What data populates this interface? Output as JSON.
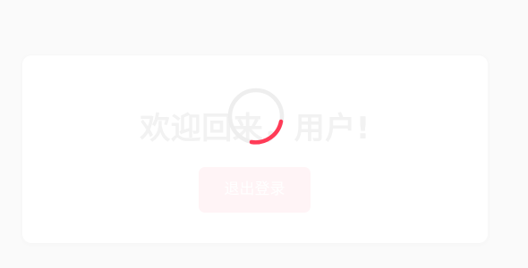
{
  "main": {
    "welcome_title": "欢迎回来，用户!",
    "logout_button_label": "退出登录"
  },
  "loading": {
    "state": "loading",
    "accent_color": "#ff3b57"
  },
  "colors": {
    "page_background": "#f7f7f7",
    "card_background": "#ffffff",
    "title_text": "#ececec",
    "button_background": "#ffeff1"
  }
}
